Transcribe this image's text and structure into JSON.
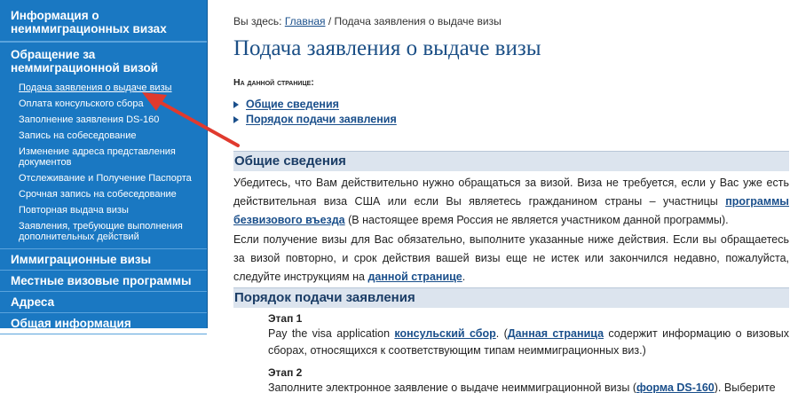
{
  "sidebar": {
    "sections": [
      {
        "label": "Информация о неиммиграционных визах"
      },
      {
        "label": "Обращение за неммиграционной визой"
      },
      {
        "label": "Иммиграционные визы"
      },
      {
        "label": "Местные визовые программы"
      },
      {
        "label": "Адреса"
      },
      {
        "label": "Общая информация"
      }
    ],
    "subitems": [
      {
        "label": "Подача заявления о выдаче визы"
      },
      {
        "label": "Оплата консульского сбора"
      },
      {
        "label": "Заполнение заявления DS-160"
      },
      {
        "label": "Запись на собеседование"
      },
      {
        "label": "Изменение адреса представления документов"
      },
      {
        "label": "Отслеживание и Получение Паспорта"
      },
      {
        "label": "Срочная запись на собеседование"
      },
      {
        "label": "Повторная выдача визы"
      },
      {
        "label": "Заявления, требующие выполнения дополнительных действий"
      }
    ]
  },
  "breadcrumb": {
    "prefix": "Вы здесь:",
    "home": "Главная",
    "sep": " / ",
    "current": "Подача заявления о выдаче визы"
  },
  "page": {
    "title": "Подача заявления о выдаче визы",
    "on_page_label": "На данной странице:",
    "toc": [
      "Общие сведения",
      "Порядок подачи заявления"
    ]
  },
  "section1": {
    "heading": "Общие сведения",
    "p1_a": "Убедитесь, что Вам действительно нужно обращаться за визой. Виза не требуется, если у Вас уже есть действительная виза США или если Вы являетесь гражданином страны – участницы ",
    "p1_link": "программы безвизового въезда",
    "p1_b": " (В настоящее время Россия не является участником данной программы).",
    "p2_a": "Если получение визы для Вас обязательно, выполните указанные ниже действия. Если вы обращаетесь за визой повторно, и срок действия вашей визы еще не истек или закончился недавно, пожалуйста, следуйте инструкциям на ",
    "p2_link": "данной странице",
    "p2_b": "."
  },
  "section2": {
    "heading": "Порядок подачи заявления",
    "step1_label": "Этап 1",
    "step1_a": "Pay the visa application ",
    "step1_link1": "консульский сбор",
    "step1_b": ". (",
    "step1_link2": "Данная страница",
    "step1_c": " содержит информацию о визовых сборах, относящихся к соответствующим типам неиммиграционных виз.)",
    "step2_label": "Этап 2",
    "step2_a": "Заполните электронное заявление о выдаче неиммиграционной визы (",
    "step2_link": "форма DS-160",
    "step2_b": "). Выберите"
  },
  "colors": {
    "sidebar": "#1a78c2",
    "link": "#1a4f8b",
    "heading": "#1b4f86",
    "section_bg": "#dce4ee",
    "arrow": "#e03a2e"
  }
}
